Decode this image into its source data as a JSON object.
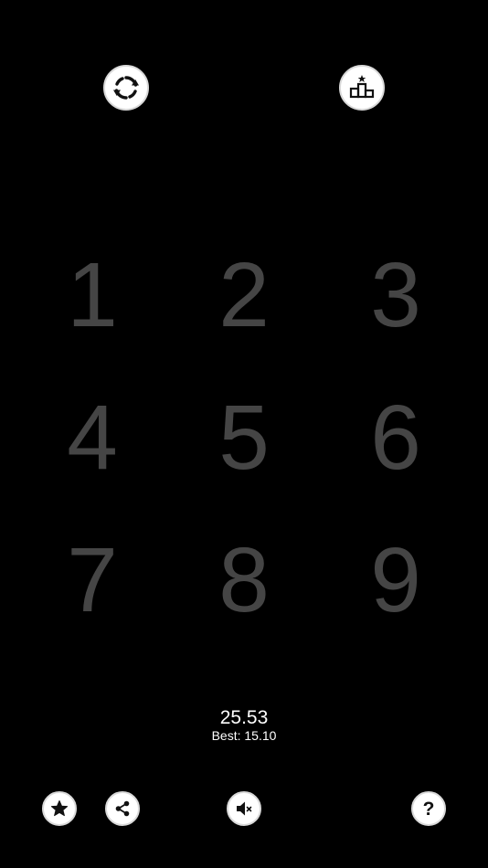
{
  "toolbar_top": {
    "restart_icon": "refresh-icon",
    "leaderboard_icon": "podium-icon"
  },
  "grid": {
    "cells": [
      "1",
      "2",
      "3",
      "4",
      "5",
      "6",
      "7",
      "8",
      "9"
    ],
    "digit_color": "#454545"
  },
  "score": {
    "current": "25.53",
    "best": "Best: 15.10"
  },
  "toolbar_bottom": {
    "rate_icon": "star-icon",
    "share_icon": "share-icon",
    "sound_icon": "speaker-muted-icon",
    "help_label": "?"
  },
  "colors": {
    "background": "#000000",
    "button": "#ffffff",
    "text": "#ffffff"
  }
}
